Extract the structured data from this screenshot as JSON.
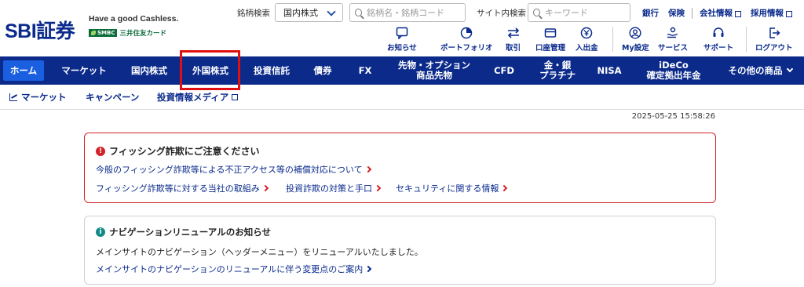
{
  "header": {
    "logo": "SBI証券",
    "tagline": "Have a good Cashless.",
    "partner_badge": "SMBC",
    "partner_text": "三井住友カード",
    "stock_search_label": "銘柄検索",
    "market_select_value": "国内株式",
    "stock_search_placeholder": "銘柄名・銘柄コード",
    "site_search_label": "サイト内検索",
    "site_search_placeholder": "キーワード",
    "top_links": [
      "銀行",
      "保険",
      "会社情報",
      "採用情報"
    ],
    "icons": [
      {
        "label": "お知らせ",
        "icon": "message-icon"
      },
      {
        "label": "ポートフォリオ",
        "icon": "portfolio-icon"
      },
      {
        "label": "取引",
        "icon": "trade-icon"
      },
      {
        "label": "口座管理",
        "icon": "account-icon"
      },
      {
        "label": "入出金",
        "icon": "deposit-icon"
      },
      {
        "label": "My設定",
        "icon": "user-settings-icon"
      },
      {
        "label": "サービス",
        "icon": "services-icon"
      },
      {
        "label": "サポート",
        "icon": "support-icon"
      },
      {
        "label": "ログアウト",
        "icon": "logout-icon"
      }
    ]
  },
  "nav": {
    "items": [
      {
        "label": "ホーム",
        "active": true
      },
      {
        "label": "マーケット"
      },
      {
        "label": "国内株式"
      },
      {
        "label": "外国株式"
      },
      {
        "label": "投資信託"
      },
      {
        "label": "債券"
      },
      {
        "label": "FX"
      },
      {
        "label": "先物・オプション\n商品先物"
      },
      {
        "label": "CFD"
      },
      {
        "label": "金・銀\nプラチナ"
      },
      {
        "label": "NISA"
      },
      {
        "label": "iDeCo\n確定拠出年金"
      },
      {
        "label": "その他の商品"
      }
    ]
  },
  "subnav": {
    "items": [
      "マーケット",
      "キャンペーン",
      "投資情報メディア"
    ]
  },
  "timestamp": "2025-05-25 15:58:26",
  "phishing_notice": {
    "badge": "!",
    "title": "フィッシング詐欺にご注意ください",
    "links": [
      "今般のフィッシング詐欺等による不正アクセス等の補償対応について",
      "フィッシング詐欺等に対する当社の取組み",
      "投資詐欺の対策と手口",
      "セキュリティに関する情報"
    ]
  },
  "renewal_notice": {
    "badge": "i",
    "title": "ナビゲーションリニューアルのお知らせ",
    "body": "メインサイトのナビゲーション（ヘッダーメニュー）をリニューアルいたしました。",
    "link": "メインサイトのナビゲーションのリニューアルに伴う変更点のご案内"
  },
  "colors": {
    "brand_navy": "#0b2a8a",
    "active_blue": "#1a5fe0",
    "alert_red": "#d2232a",
    "info_teal": "#148a87"
  }
}
